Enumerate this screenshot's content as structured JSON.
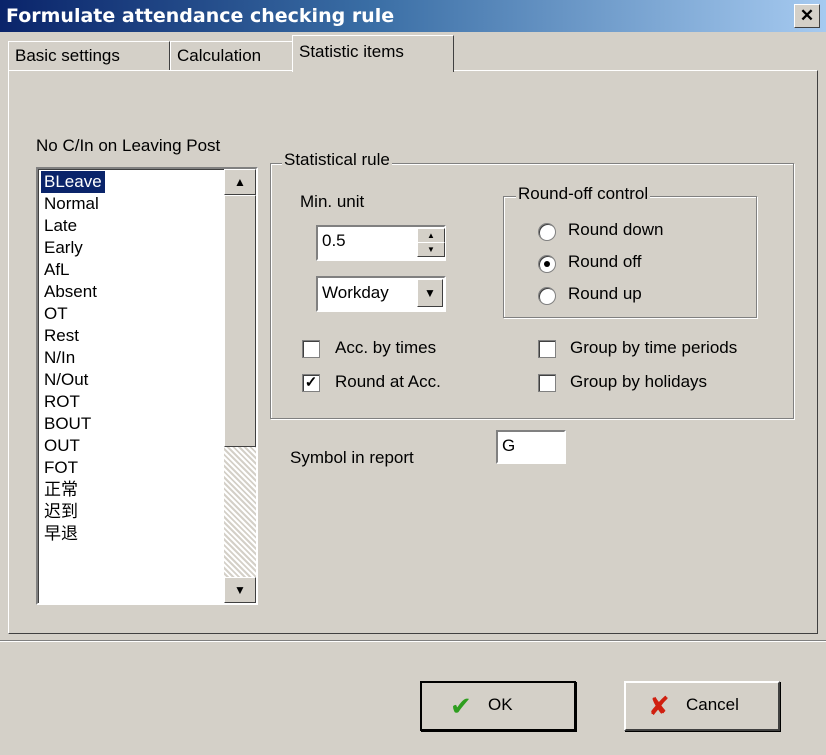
{
  "window": {
    "title": "Formulate attendance checking rule",
    "close_glyph": "✕"
  },
  "tabs": [
    {
      "label": "Basic settings"
    },
    {
      "label": "Calculation"
    },
    {
      "label": "Statistic items"
    }
  ],
  "list": {
    "label": "No C/In on Leaving Post",
    "items": [
      "BLeave",
      "Normal",
      "Late",
      "Early",
      "AfL",
      "Absent",
      "OT",
      "Rest",
      "N/In",
      "N/Out",
      "ROT",
      "BOUT",
      "OUT",
      "FOT",
      "正常",
      "迟到",
      "早退"
    ],
    "selected": "BLeave"
  },
  "statistical_rule": {
    "title": "Statistical rule",
    "min_unit_label": "Min. unit",
    "min_unit_value": "0.5",
    "unit_select_value": "Workday",
    "round_off": {
      "title": "Round-off control",
      "options": [
        "Round down",
        "Round off",
        "Round up"
      ],
      "selected": "Round off"
    },
    "checkboxes": {
      "acc_by_times": {
        "label": "Acc. by times",
        "checked": false
      },
      "round_at_acc": {
        "label": "Round at Acc.",
        "checked": true
      },
      "group_by_time_periods": {
        "label": "Group by time periods",
        "checked": false
      },
      "group_by_holidays": {
        "label": "Group by holidays",
        "checked": false
      }
    }
  },
  "symbol": {
    "label": "Symbol in report",
    "value": "G"
  },
  "buttons": {
    "ok": {
      "label": "OK",
      "icon": "check-icon",
      "color": "#2e9e1f"
    },
    "cancel": {
      "label": "Cancel",
      "icon": "x-icon",
      "color": "#d02010"
    }
  }
}
